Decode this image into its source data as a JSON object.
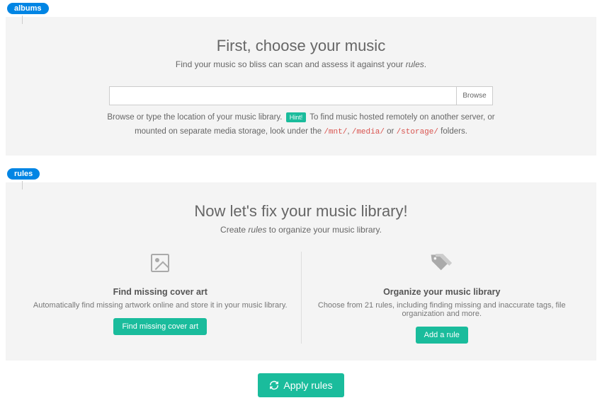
{
  "albums": {
    "tag": "albums",
    "title": "First, choose your music",
    "sub_pre": "Find your music so bliss can scan and assess it against your ",
    "sub_em": "rules",
    "sub_post": ".",
    "browse_label": "Browse",
    "hint_pre": "Browse or type the location of your music library. ",
    "hint_badge": "Hint!",
    "hint_mid": " To find music hosted remotely on another server, or mounted on separate media storage, look under the ",
    "hint_code1": "/mnt/",
    "hint_sep1": ", ",
    "hint_code2": "/media/",
    "hint_or": " or ",
    "hint_code3": "/storage/",
    "hint_post": " folders."
  },
  "rules": {
    "tag": "rules",
    "title": "Now let's fix your music library!",
    "sub_pre": "Create ",
    "sub_em": "rules",
    "sub_post": " to organize your music library.",
    "cover": {
      "heading": "Find missing cover art",
      "desc": "Automatically find missing artwork online and store it in your music library.",
      "button": "Find missing cover art"
    },
    "organize": {
      "heading": "Organize your music library",
      "desc": "Choose from 21 rules, including finding missing and inaccurate tags, file organization and more.",
      "button": "Add a rule"
    }
  },
  "apply": {
    "label": "Apply rules"
  }
}
